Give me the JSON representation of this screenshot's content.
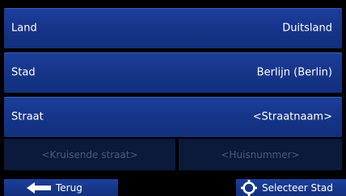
{
  "fields": {
    "country": {
      "label": "Land",
      "value": "Duitsland"
    },
    "city": {
      "label": "Stad",
      "value": "Berlijn (Berlin)"
    },
    "street": {
      "label": "Straat",
      "value": "<Straatnaam>"
    }
  },
  "disabled": {
    "crossing_street": "<Kruisende straat>",
    "house_number": "<Huisnummer>"
  },
  "buttons": {
    "back": {
      "label": "Terug",
      "icon": "arrow-left-icon"
    },
    "select_city": {
      "label": "Selecteer Stad",
      "icon": "crosshair-icon"
    }
  },
  "colors": {
    "button_blue": "#163487",
    "disabled_bg": "#0b1a3b",
    "disabled_text": "#4a5a7c"
  }
}
